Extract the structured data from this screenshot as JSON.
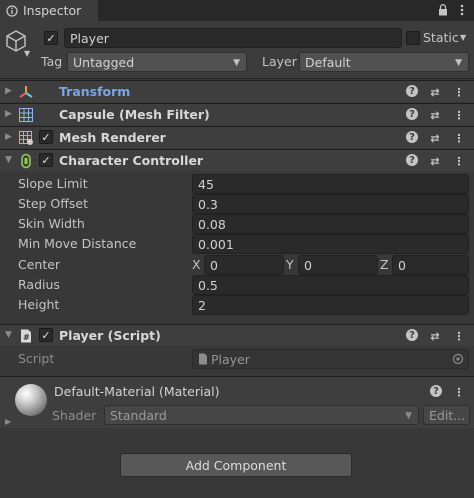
{
  "window": {
    "tab_title": "Inspector"
  },
  "header": {
    "active": true,
    "object_name": "Player",
    "static_label": "Static",
    "tag_label": "Tag",
    "tag_value": "Untagged",
    "layer_label": "Layer",
    "layer_value": "Default"
  },
  "components": {
    "transform": {
      "name": "Transform"
    },
    "mesh_filter": {
      "name": "Capsule (Mesh Filter)"
    },
    "mesh_renderer": {
      "name": "Mesh Renderer",
      "enabled": true
    },
    "character_controller": {
      "name": "Character Controller",
      "enabled": true,
      "props": {
        "slope_limit": {
          "label": "Slope Limit",
          "value": "45"
        },
        "step_offset": {
          "label": "Step Offset",
          "value": "0.3"
        },
        "skin_width": {
          "label": "Skin Width",
          "value": "0.08"
        },
        "min_move_distance": {
          "label": "Min Move Distance",
          "value": "0.001"
        },
        "center": {
          "label": "Center",
          "x_label": "X",
          "x": "0",
          "y_label": "Y",
          "y": "0",
          "z_label": "Z",
          "z": "0"
        },
        "radius": {
          "label": "Radius",
          "value": "0.5"
        },
        "height": {
          "label": "Height",
          "value": "2"
        }
      }
    },
    "player_script": {
      "name": "Player (Script)",
      "enabled": true,
      "script_label": "Script",
      "script_value": "Player"
    }
  },
  "material": {
    "name": "Default-Material (Material)",
    "shader_label": "Shader",
    "shader_value": "Standard",
    "edit_label": "Edit..."
  },
  "footer": {
    "add_component_label": "Add Component"
  },
  "icons": {
    "tab": "inspector-icon",
    "gameobject": "cube-icon",
    "transform": "transform-axes-icon",
    "mesh_filter": "grid-icon",
    "mesh_renderer": "mesh-renderer-icon",
    "character_controller": "character-controller-icon",
    "script": "script-icon",
    "help": "help-icon",
    "presets": "presets-icon",
    "menu": "kebab-menu-icon"
  },
  "colors": {
    "background": "#383838",
    "header": "#3c3c3c",
    "field": "#2a2a2a",
    "transform_label": "#7aa6e8"
  }
}
